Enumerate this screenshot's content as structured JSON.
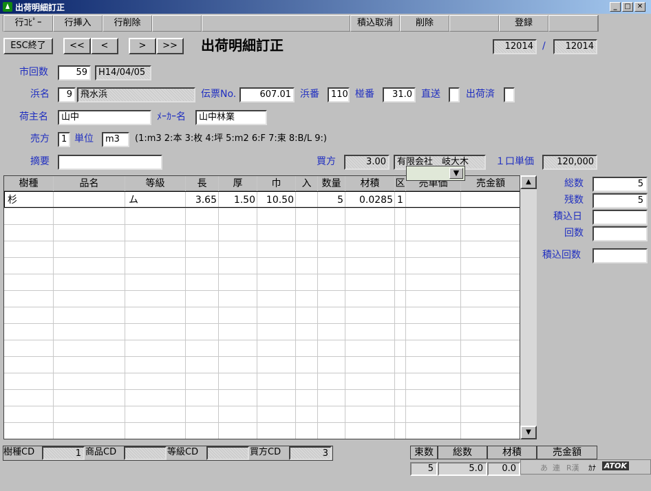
{
  "window": {
    "title": "出荷明細訂正",
    "min": "_",
    "max": "□",
    "close": "✕"
  },
  "toolbar": [
    "行ｺﾋﾟｰ",
    "行挿入",
    "行削除",
    "",
    "",
    "積込取消",
    "削除",
    "",
    "登録",
    ""
  ],
  "nav": {
    "esc": "ESC終了",
    "first": "<<",
    "prev": "<",
    "next": ">",
    "last": ">>",
    "heading": "出荷明細訂正",
    "page_current": "12014",
    "page_sep": "/",
    "page_total": "12014"
  },
  "form": {
    "ichi_kaisu_label": "市回数",
    "ichi_kaisu": "59",
    "date": "H14/04/05",
    "hama_label": "浜名",
    "hama_code": "9",
    "hama_name": "飛水浜",
    "denpyo_label": "伝票No.",
    "denpyo": "607.01",
    "hama_ban_label": "浜番",
    "hama_ban": "110",
    "ha_ban_label": "椪番",
    "ha_ban": "31.0",
    "chokuso_label": "直送",
    "shukka_label": "出荷済",
    "ninushi_label": "荷主名",
    "ninushi": "山中",
    "maker_label": "ﾒｰｶｰ名",
    "maker": "山中林業",
    "urikata_label": "売方",
    "urikata": "1",
    "tani_label": "単位",
    "tani": "m3",
    "tani_hint": "(1:m3 2:本 3:枚 4:坪 5:m2 6:F 7:束 8:B/L 9:)",
    "tekiyo_label": "摘要",
    "tekiyo": "",
    "kaikata_label": "買方",
    "kaikata_val": "3.00",
    "kaikata_name": "有限会社　岐大木",
    "kuchi_label": "１口単価",
    "kuchi_val": "120,000",
    "dropdown_arrow": "▼"
  },
  "grid": {
    "headers": [
      "樹種",
      "品名",
      "等級",
      "長",
      "厚",
      "巾",
      "入",
      "数量",
      "材積",
      "区",
      "売単価",
      "売金額"
    ],
    "rows": [
      [
        "杉",
        "",
        "ム",
        "3.65",
        "1.50",
        "10.50",
        "",
        "5",
        "0.0285",
        "1",
        "",
        ""
      ]
    ],
    "scroll_up": "▲",
    "scroll_down": "▼"
  },
  "right": {
    "sosu_label": "総数",
    "sosu": "5",
    "zansu_label": "残数",
    "zansu": "5",
    "tsumikomi_bi_label": "積込日",
    "tsumikomi_bi": "",
    "kaisu_label": "回数",
    "kaisu": "",
    "tsumikomi_kaisu_label": "積込回数",
    "tsumikomi_kaisu": ""
  },
  "bottom": {
    "jushu_cd_label": "樹種CD",
    "jushu_cd": "1",
    "shohin_cd_label": "商品CD",
    "shohin_cd": "",
    "tokyu_cd_label": "等級CD",
    "tokyu_cd": "",
    "kaikata_cd_label": "買方CD",
    "kaikata_cd": "3"
  },
  "summary": {
    "headers": [
      "束数",
      "総数",
      "材積",
      "売金額"
    ],
    "values": [
      "5",
      "5.0",
      "0.0",
      ""
    ]
  },
  "ime": [
    "あ",
    "連",
    "R漢",
    "ｶﾅ",
    "ATOK"
  ]
}
